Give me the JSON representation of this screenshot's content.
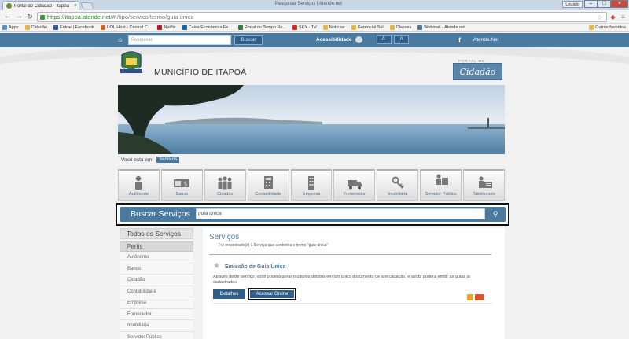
{
  "browser": {
    "tab_title": "Portal do Cidadão - Itapoá",
    "window_title": "Pesquisar Serviços | Atende.net",
    "user_label": "Usuário",
    "url_host": "https://itapoa.atende.net",
    "url_path": "/#!/tipo/servico/termo/guia única",
    "bookmarks": [
      "Apps",
      "Cidadão",
      "Entrar | Facebook",
      "UOL Host - Central C...",
      "Netflix",
      "Caixa Econômica Fe...",
      "Portal do Tempo Re...",
      "SKY - TV",
      "Notícias",
      "Gerencial Sul",
      "Classes",
      "Webmail - Atende.net"
    ],
    "other_bookmarks": "Outros favoritos",
    "colors": {
      "secure": "#1f8a1f",
      "tab_strip": "#c9d6e6"
    }
  },
  "topbar": {
    "search_placeholder": "Pesquisar",
    "search_button": "Buscar",
    "accessibility_label": "Acessibilidade",
    "font_decrease": "A-",
    "font_increase": "A",
    "atende_link": "Atende.Net",
    "colors": {
      "bar": "#4b7aa1",
      "button": "#2f5e88"
    }
  },
  "header": {
    "municipality": "MUNICÍPIO DE ITAPOÁ",
    "portal_badge": "Cidadão",
    "portal_small": "PORTAL DO"
  },
  "breadcrumb": {
    "label": "Você está em:",
    "current": "Serviços"
  },
  "categories": [
    {
      "label": "Autônomo",
      "icon": "person-icon"
    },
    {
      "label": "Banco",
      "icon": "money-icon"
    },
    {
      "label": "Cidadão",
      "icon": "people-icon"
    },
    {
      "label": "Contabilidade",
      "icon": "calculator-icon"
    },
    {
      "label": "Empresa",
      "icon": "building-icon"
    },
    {
      "label": "Fornecedor",
      "icon": "supplier-icon"
    },
    {
      "label": "Imobiliária",
      "icon": "keys-icon"
    },
    {
      "label": "Servidor Público",
      "icon": "server-icon"
    },
    {
      "label": "Tabelionato",
      "icon": "notary-icon"
    }
  ],
  "service_search": {
    "title": "Buscar Serviços",
    "query": "guia única"
  },
  "sidebar": {
    "all_services": "Todos os Serviços",
    "section": "Perfis",
    "items": [
      "Autônomo",
      "Banco",
      "Cidadão",
      "Contabilidade",
      "Empresa",
      "Fornecedor",
      "Imobiliária",
      "Servidor Público"
    ]
  },
  "results": {
    "title": "Serviços",
    "count_text": "Foi encontrado(s) 1 Serviço que contenha o termo \"guia única\"",
    "items": [
      {
        "name": "Emissão de Guia Única",
        "description": "Através deste serviço, você poderá gerar múltiplos débitos em um único documento de arrecadação, e ainda poderá emitir as guias já cadastradas.",
        "details_button": "Detalhes",
        "access_button": "Acessar Online"
      }
    ]
  }
}
